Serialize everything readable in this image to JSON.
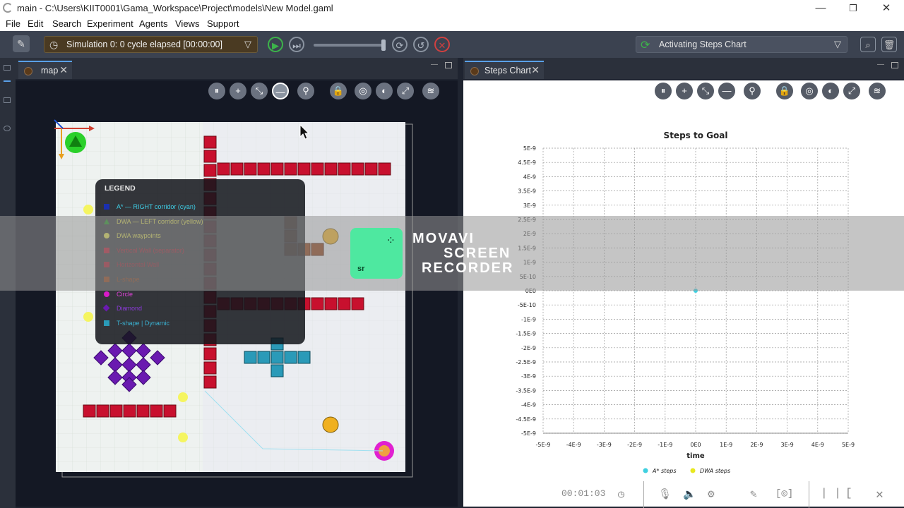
{
  "window": {
    "title": "main - C:\\Users\\KIIT0001\\Gama_Workspace\\Project\\models\\New Model.gaml",
    "minimize": "—",
    "maximize": "❐",
    "close": "✕"
  },
  "menu": [
    "File",
    "Edit",
    "Search",
    "Experiment",
    "Agents",
    "Views",
    "Support"
  ],
  "toolbar": {
    "sim_status": "Simulation 0: 0 cycle elapsed [00:00:00]",
    "activity": "Activating Steps Chart"
  },
  "map_tab": {
    "label": "map"
  },
  "chart_tab": {
    "label": "Steps Chart"
  },
  "legend": {
    "title": "LEGEND",
    "items": [
      {
        "label": "A* — RIGHT corridor (cyan)",
        "color": "#1a2fb0",
        "shape": "square",
        "text_color": "#3fd0e8"
      },
      {
        "label": "DWA — LEFT  corridor (yellow)",
        "color": "#1a8a1a",
        "shape": "triangle",
        "text_color": "#d8d84a"
      },
      {
        "label": "DWA waypoints",
        "color": "#d8d84a",
        "shape": "circle",
        "text_color": "#d8d84a"
      },
      {
        "label": "Vertical Wall (separator)",
        "color": "#b0142a",
        "shape": "square",
        "text_color": "#a01a2a"
      },
      {
        "label": "Horizontal Wall",
        "color": "#a01428",
        "shape": "square",
        "text_color": "#901a28"
      },
      {
        "label": "L-shape",
        "color": "#8a3a10",
        "shape": "square",
        "text_color": "#8a3a10"
      },
      {
        "label": "Circle",
        "color": "#d81ac8",
        "shape": "circle",
        "text_color": "#e040d8"
      },
      {
        "label": "Diamond",
        "color": "#6a1ab0",
        "shape": "diamond",
        "text_color": "#8a3ad8"
      },
      {
        "label": "T-shape  |  Dynamic",
        "color": "#2a9ab8",
        "shape": "square",
        "text_color": "#3ab0d0"
      }
    ]
  },
  "watermark": {
    "line1": "MOVAVI",
    "line2": "SCREEN",
    "line3": "RECORDER",
    "logo_text": "sr"
  },
  "recorder": {
    "time": "00:01:03"
  },
  "chart_data": {
    "type": "scatter",
    "title": "Steps to Goal",
    "xlabel": "time",
    "ylabel": "",
    "xlim": [
      -5e-09,
      5e-09
    ],
    "ylim": [
      -5e-09,
      5e-09
    ],
    "x_ticks": [
      "-5E-9",
      "-4E-9",
      "-3E-9",
      "-2E-9",
      "-1E-9",
      "0E0",
      "1E-9",
      "2E-9",
      "3E-9",
      "4E-9",
      "5E-9"
    ],
    "y_ticks": [
      "5E-9",
      "4.5E-9",
      "4E-9",
      "3.5E-9",
      "3E-9",
      "2.5E-9",
      "2E-9",
      "1.5E-9",
      "1E-9",
      "5E-10",
      "0E0",
      "-5E-10",
      "-1E-9",
      "-1.5E-9",
      "-2E-9",
      "-2.5E-9",
      "-3E-9",
      "-3.5E-9",
      "-4E-9",
      "-4.5E-9",
      "-5E-9"
    ],
    "grid": true,
    "legend_position": "bottom",
    "series": [
      {
        "name": "A* steps",
        "color": "#3fd0e0",
        "x": [
          0
        ],
        "y": [
          0
        ]
      },
      {
        "name": "DWA steps",
        "color": "#e8e820",
        "x": [],
        "y": []
      }
    ]
  }
}
